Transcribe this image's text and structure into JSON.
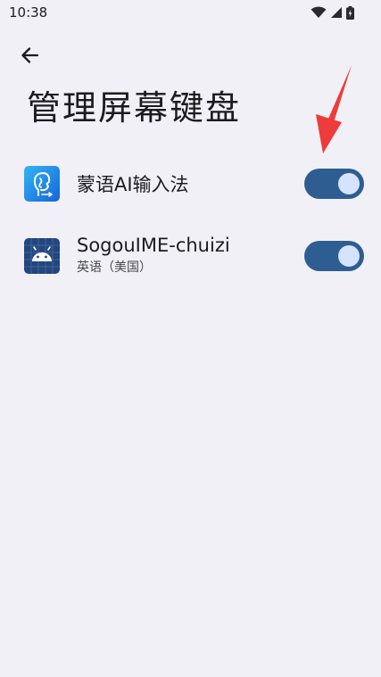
{
  "status_bar": {
    "time": "10:38"
  },
  "page": {
    "title": "管理屏幕键盘"
  },
  "keyboards": [
    {
      "name": "蒙语AI输入法",
      "subtitle": "",
      "enabled": true
    },
    {
      "name": "SogouIME-chuizi",
      "subtitle": "英语（美国）",
      "enabled": true
    }
  ],
  "colors": {
    "background": "#f1f0f6",
    "toggle_track": "#2e5e91",
    "toggle_thumb": "#d6e3ff",
    "annotation_arrow": "#ee3b3b"
  },
  "icons": {
    "back": "arrow-left-icon",
    "wifi": "wifi-icon",
    "signal": "signal-icon",
    "battery": "battery-icon",
    "app1": "mongol-ime-icon",
    "app2": "android-robot-icon"
  }
}
